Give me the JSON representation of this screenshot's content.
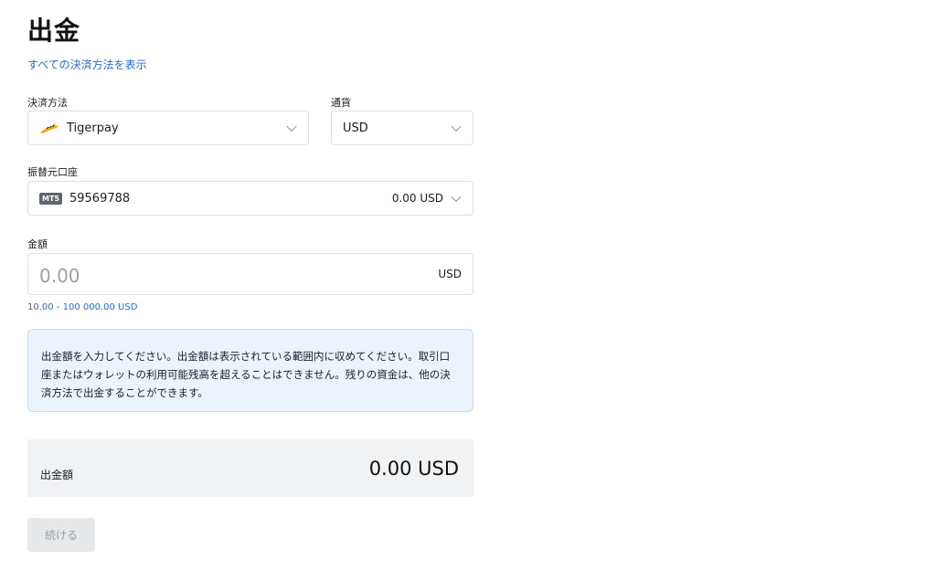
{
  "page": {
    "title": "出金",
    "show_all_methods_link": "すべての決済方法を表示"
  },
  "payment_method": {
    "label": "決済方法",
    "value": "Tigerpay",
    "icon": "tigerpay-logo-icon"
  },
  "currency": {
    "label": "通貨",
    "value": "USD"
  },
  "source_account": {
    "label": "振替元口座",
    "badge": "MT5",
    "account_number": "59569788",
    "balance": "0.00 USD"
  },
  "amount": {
    "label": "金額",
    "placeholder": "0.00",
    "value": "",
    "currency": "USD",
    "range_hint": "10.00 - 100 000.00 USD"
  },
  "info_box": {
    "text": "出金額を入力してください。出金額は表示されている範囲内に収めてください。取引口座またはウォレットの利用可能残高を超えることはできません。残りの資金は、他の決済方法で出金することができます。"
  },
  "summary": {
    "label": "出金額",
    "value": "0.00 USD"
  },
  "continue_button": {
    "label": "続ける",
    "enabled": false
  },
  "colors": {
    "link": "#2a6bd4",
    "info_bg": "#edf3fd",
    "info_border": "#c9daf5",
    "summary_bg": "#f1f2f4",
    "disabled_button_bg": "#e7e8ea"
  }
}
